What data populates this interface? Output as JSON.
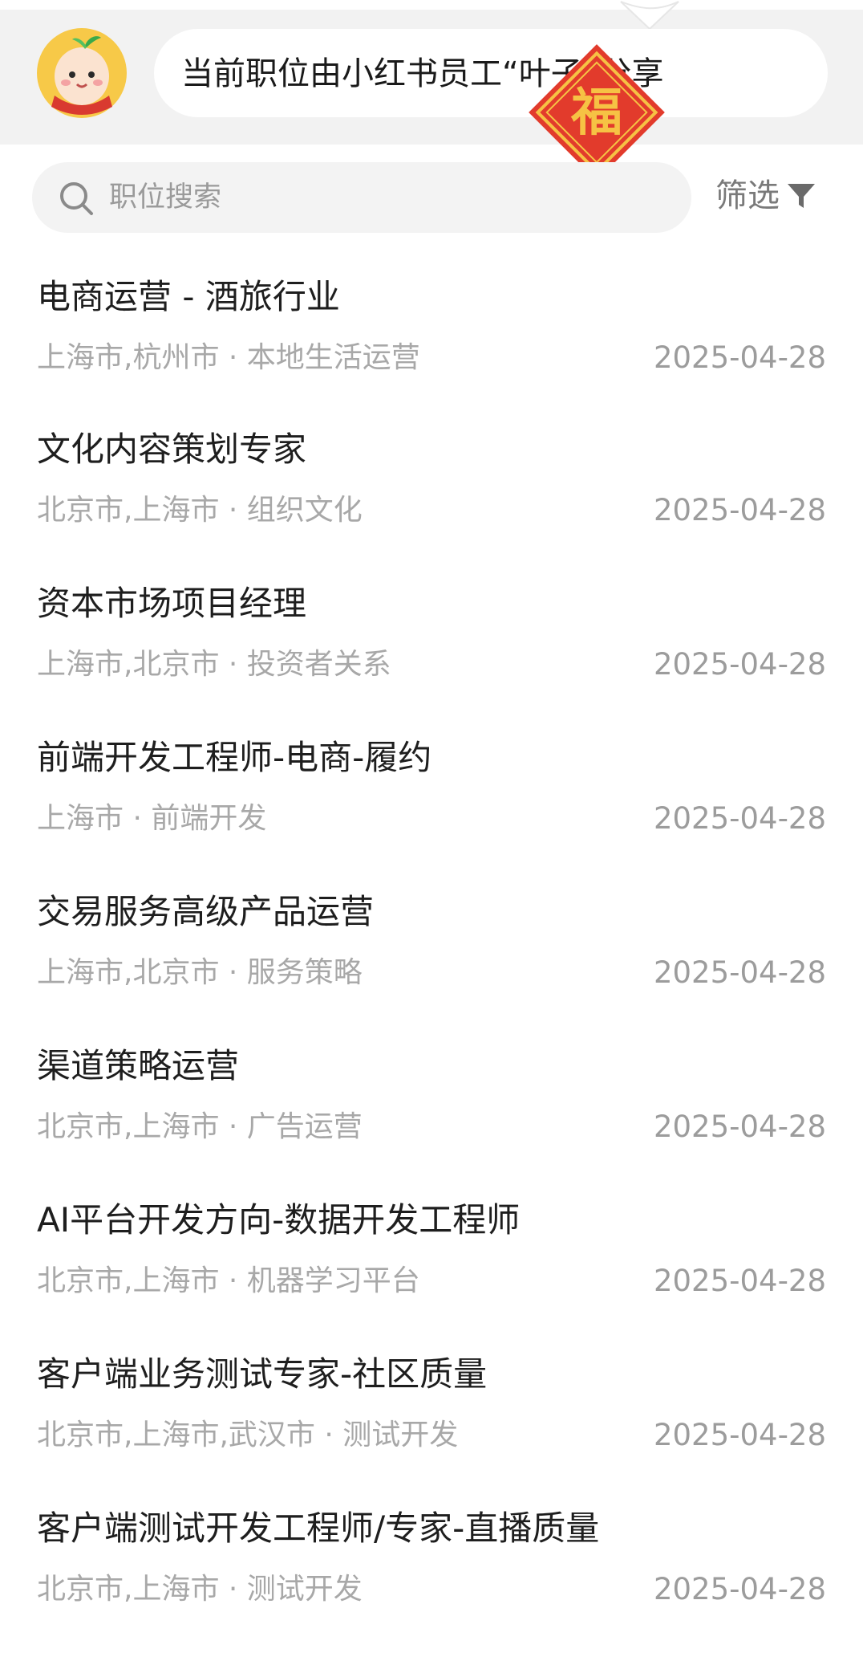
{
  "header": {
    "share_text": "当前职位由小红书员工“叶子”分享",
    "badge_char": "福"
  },
  "search": {
    "placeholder": "职位搜索",
    "filter_label": "筛选"
  },
  "jobs": [
    {
      "title": "电商运营 - 酒旅行业",
      "meta": "上海市,杭州市 · 本地生活运营",
      "date": "2025-04-28"
    },
    {
      "title": "文化内容策划专家",
      "meta": "北京市,上海市 · 组织文化",
      "date": "2025-04-28"
    },
    {
      "title": "资本市场项目经理",
      "meta": "上海市,北京市 · 投资者关系",
      "date": "2025-04-28"
    },
    {
      "title": "前端开发工程师-电商-履约",
      "meta": "上海市 · 前端开发",
      "date": "2025-04-28"
    },
    {
      "title": "交易服务高级产品运营",
      "meta": "上海市,北京市 · 服务策略",
      "date": "2025-04-28"
    },
    {
      "title": "渠道策略运营",
      "meta": "北京市,上海市 · 广告运营",
      "date": "2025-04-28"
    },
    {
      "title": "AI平台开发方向-数据开发工程师",
      "meta": "北京市,上海市 · 机器学习平台",
      "date": "2025-04-28"
    },
    {
      "title": "客户端业务测试专家-社区质量",
      "meta": "北京市,上海市,武汉市 · 测试开发",
      "date": "2025-04-28"
    },
    {
      "title": "客户端测试开发工程师/专家-直播质量",
      "meta": "北京市,上海市 · 测试开发",
      "date": "2025-04-28"
    }
  ],
  "colors": {
    "badge_red": "#e23b2c",
    "badge_gold": "#f6c244",
    "banner_bg": "#f2f2f2"
  }
}
